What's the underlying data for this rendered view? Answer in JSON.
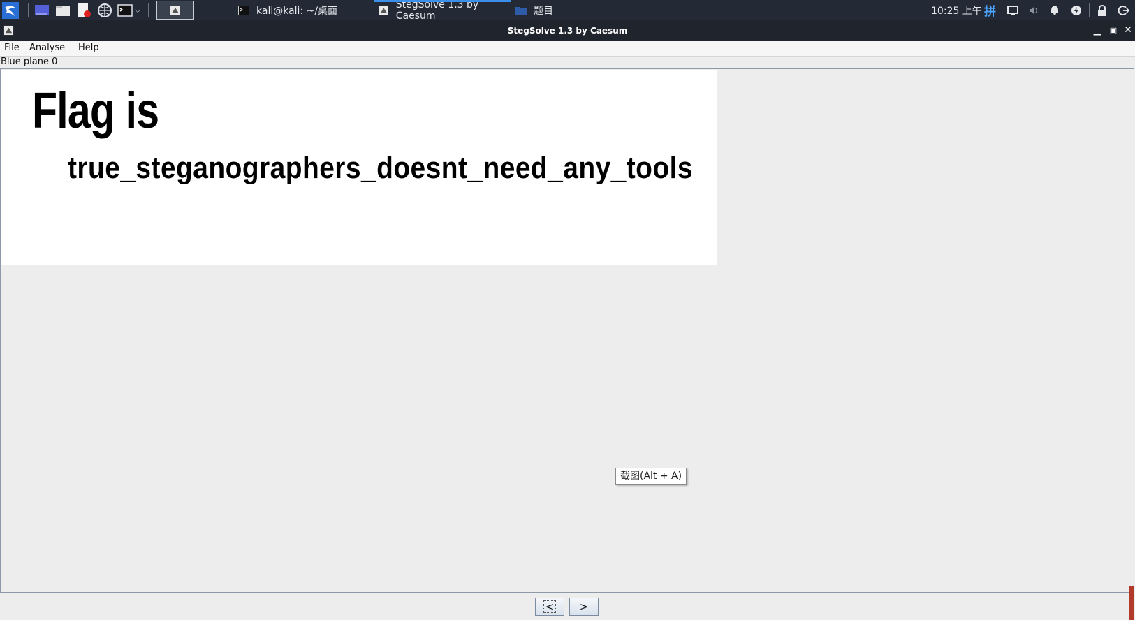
{
  "taskbar": {
    "launchers": [
      {
        "icon": "kali-menu-icon"
      },
      {
        "icon": "desktop-icon"
      },
      {
        "icon": "file-manager-icon"
      },
      {
        "icon": "text-editor-icon"
      },
      {
        "icon": "web-browser-icon"
      },
      {
        "icon": "terminal-icon"
      }
    ],
    "tasks": [
      {
        "label": "kali@kali: ~/桌面",
        "icon": "terminal-icon"
      },
      {
        "label": "StegSolve 1.3 by Caesum",
        "icon": "stegsolve-icon",
        "active": true
      },
      {
        "label": "题目",
        "icon": "folder-icon"
      }
    ],
    "clock": "10:25 上午",
    "input_method": "拼"
  },
  "window": {
    "title": "StegSolve 1.3 by Caesum"
  },
  "menu": {
    "file": "File",
    "analyse": "Analyse",
    "help": "Help"
  },
  "viewer": {
    "plane_label": "Blue plane 0",
    "image_heading": "Flag is",
    "image_flag": "true_steganographers_doesnt_need_any_tools"
  },
  "tooltip": "截图(Alt + A)",
  "nav": {
    "prev": "<",
    "next": ">"
  },
  "colors": {
    "taskbar_bg": "#232a36",
    "titlebar_bg": "#1f242d",
    "active_accent": "#3b8eea",
    "panel_bg": "#ededed"
  }
}
